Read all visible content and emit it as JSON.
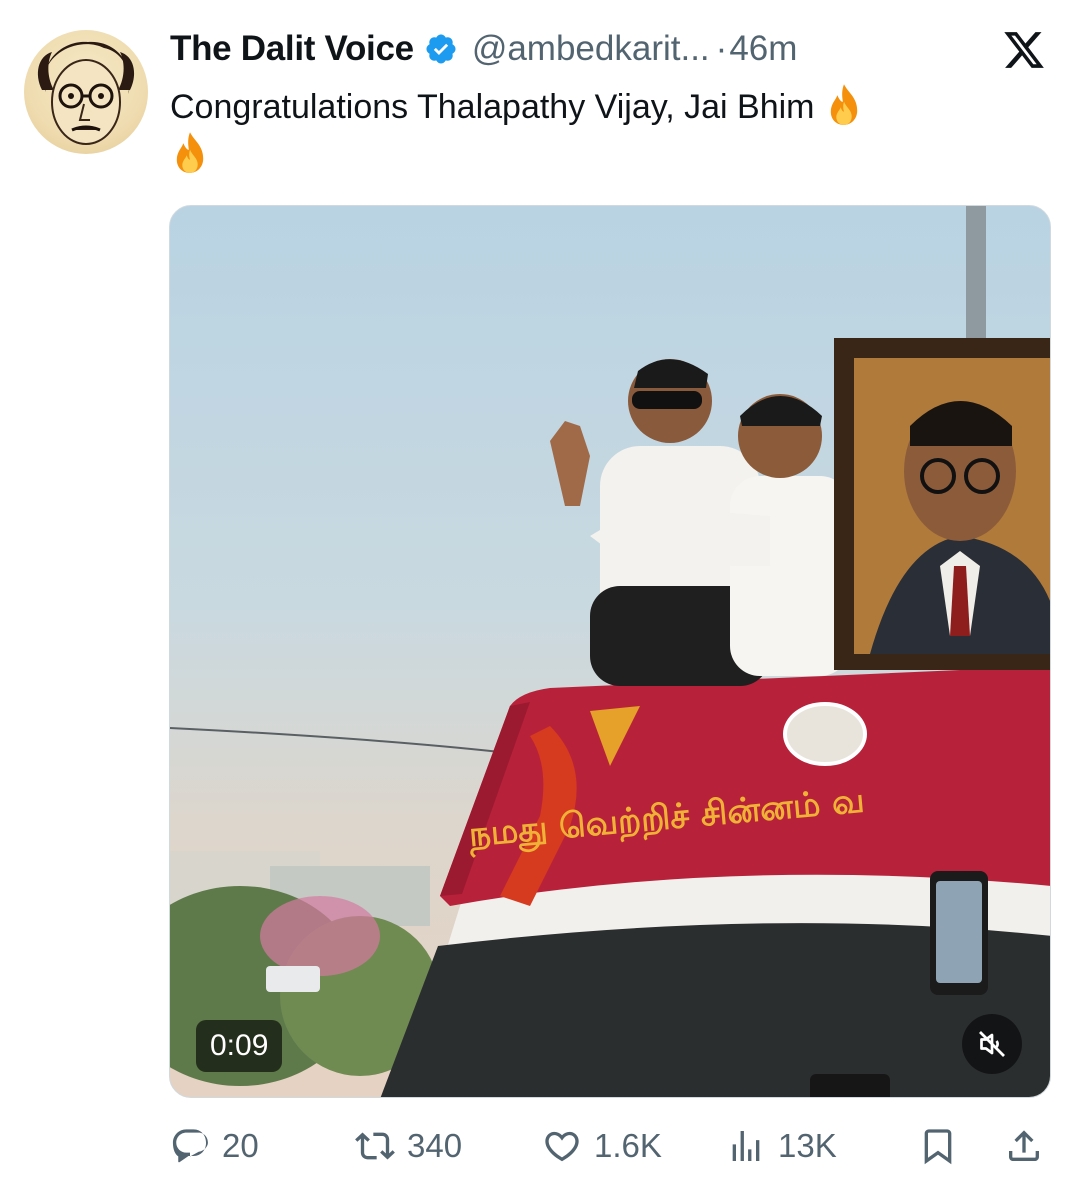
{
  "tweet": {
    "display_name": "The Dalit Voice",
    "handle": "@ambedkarit...",
    "separator": "·",
    "time": "46m",
    "text": "Congratulations Thalapathy Vijay, Jai Bhim",
    "emojis": [
      "fire",
      "fire"
    ],
    "verified_color": "#1d9bf0"
  },
  "media": {
    "duration": "0:09",
    "vehicle_text": "நமது வெற்றிச் சின்னம் வ",
    "muted": true
  },
  "actions": {
    "replies": "20",
    "retweets": "340",
    "likes": "1.6K",
    "views": "13K"
  },
  "icons": [
    "avatar",
    "verified-badge-icon",
    "x-logo-icon",
    "fire-emoji-icon",
    "mute-icon",
    "reply-icon",
    "retweet-icon",
    "like-icon",
    "views-icon",
    "bookmark-icon",
    "share-icon"
  ],
  "colors": {
    "text": "#0f1419",
    "secondary": "#536471",
    "accent": "#1d9bf0"
  }
}
